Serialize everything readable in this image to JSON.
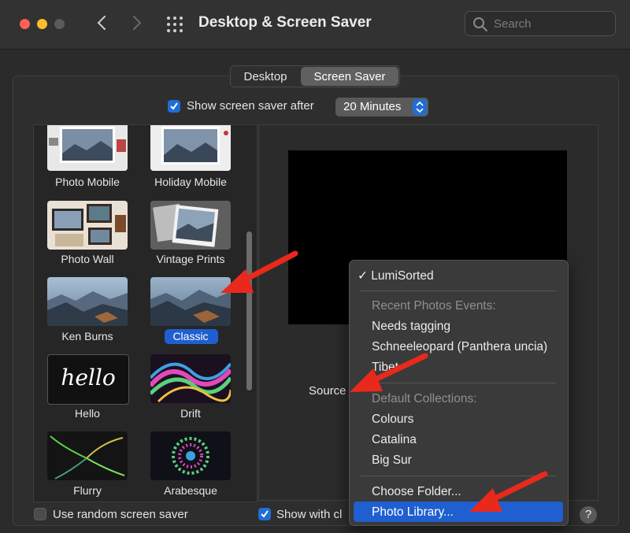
{
  "window": {
    "title": "Desktop & Screen Saver",
    "search_placeholder": "Search"
  },
  "tabs": [
    {
      "label": "Desktop"
    },
    {
      "label": "Screen Saver",
      "selected": true
    }
  ],
  "show_after": {
    "label": "Show screen saver after",
    "checked": true,
    "value": "20 Minutes"
  },
  "screen_savers": [
    {
      "label": "Photo Mobile"
    },
    {
      "label": "Holiday Mobile"
    },
    {
      "label": "Photo Wall"
    },
    {
      "label": "Vintage Prints"
    },
    {
      "label": "Ken Burns"
    },
    {
      "label": "Classic",
      "selected": true
    },
    {
      "label": "Hello",
      "thumb_text": "hello"
    },
    {
      "label": "Drift"
    },
    {
      "label": "Flurry"
    },
    {
      "label": "Arabesque"
    }
  ],
  "source": {
    "label": "Source"
  },
  "source_menu": {
    "checked_item": "LumiSorted",
    "recent_header": "Recent Photos Events:",
    "recent": [
      "Needs tagging",
      "Schneeleopard (Panthera uncia)",
      "Tibet"
    ],
    "default_header": "Default Collections:",
    "defaults": [
      "Colours",
      "Catalina",
      "Big Sur"
    ],
    "choose_folder": "Choose Folder...",
    "photo_library": "Photo Library..."
  },
  "bottom": {
    "random_label": "Use random screen saver",
    "random_checked": false,
    "show_clock_label": "Show with cl",
    "show_clock_checked": true,
    "help": "?"
  },
  "colors": {
    "accent": "#1f5fd0",
    "annotation_arrow": "#e8291c"
  }
}
